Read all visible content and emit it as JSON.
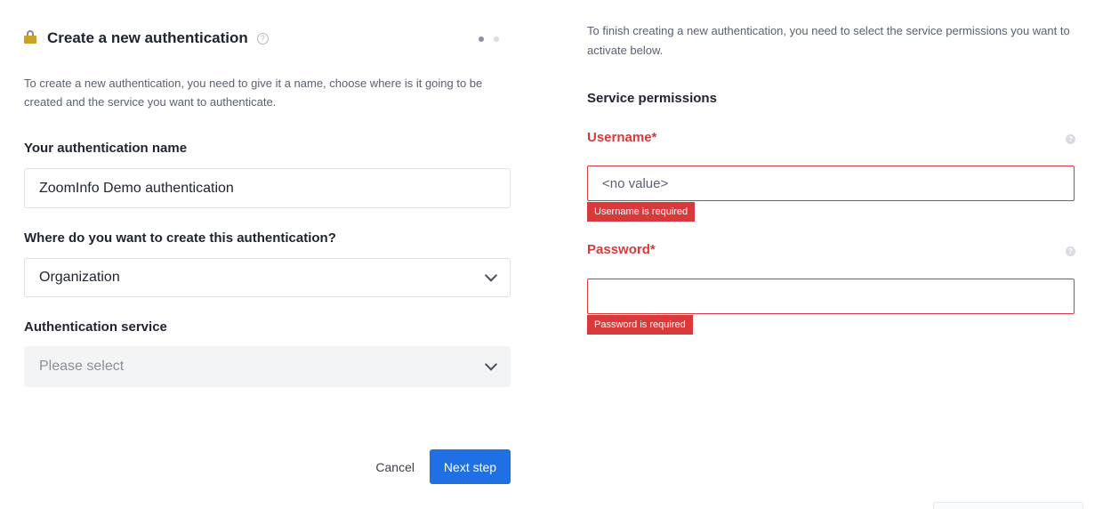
{
  "left_panel": {
    "title": "Create a new authentication",
    "help_glyph": "?",
    "description": "To create a new authentication, you need to give it a name, choose where is it going to be created and the service you want to authenticate.",
    "step_indicator": {
      "current": 1,
      "total": 2
    },
    "name_field": {
      "label": "Your authentication name",
      "value": "ZoomInfo Demo authentication"
    },
    "location_field": {
      "label": "Where do you want to create this authentication?",
      "value": "Organization"
    },
    "service_field": {
      "label": "Authentication service",
      "placeholder": "Please select"
    },
    "cancel_label": "Cancel",
    "next_label": "Next step"
  },
  "right_panel": {
    "description": "To finish creating a new authentication, you need to select the service permissions you want to activate below.",
    "section_title": "Service permissions",
    "help_glyph": "?",
    "username_field": {
      "label": "Username*",
      "placeholder": "<no value>",
      "error": "Username is required"
    },
    "password_field": {
      "label": "Password*",
      "placeholder": "",
      "error": "Password is required"
    }
  },
  "colors": {
    "primary": "#1f6fe5",
    "error": "#d83a3a",
    "lock": "#c9a227"
  },
  "icons": [
    "lock-icon",
    "help-circle-icon",
    "chevron-down-icon"
  ]
}
